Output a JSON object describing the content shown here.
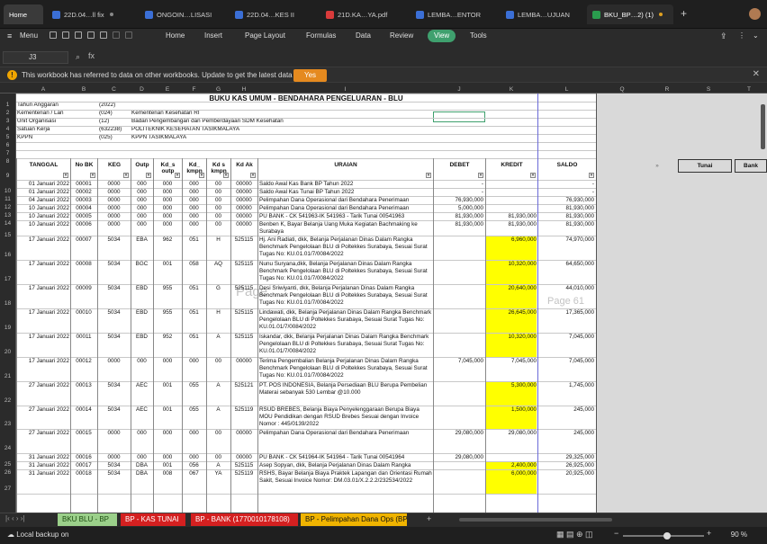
{
  "tabs": [
    {
      "label": "Home"
    },
    {
      "label": "22D.04…ll fix"
    },
    {
      "label": "ONGOIN…LISASI"
    },
    {
      "label": "22D.04…KES II"
    },
    {
      "label": "21D.KA…YA.pdf"
    },
    {
      "label": "LEMBA…ENTOR"
    },
    {
      "label": "LEMBA…UJUAN"
    },
    {
      "label": "BKU_BP…2) (1)"
    }
  ],
  "menu": {
    "menu_label": "Menu",
    "items": [
      "Home",
      "Insert",
      "Page Layout",
      "Formulas",
      "Data",
      "Review",
      "View",
      "Tools"
    ],
    "active": "View"
  },
  "banner": {
    "message": "This workbook has referred to data on other workbooks. Update to get the latest data ?",
    "yes": "Yes"
  },
  "formula": {
    "cell": "J3",
    "fx": "fx"
  },
  "columns": [
    "A",
    "B",
    "C",
    "D",
    "E",
    "F",
    "G",
    "H",
    "I",
    "J",
    "K",
    "L",
    "Q",
    "R",
    "S",
    "T"
  ],
  "title": "BUKU KAS UMUM - BENDAHARA PENGELUARAN - BLU",
  "info": [
    {
      "label": "Tahun Anggaran",
      "code": "(2022)",
      "value": ""
    },
    {
      "label": "Kementerian / Lan",
      "code": "(024)",
      "value": "Kementerian Kesehatan RI"
    },
    {
      "label": "Unit Organisasi",
      "code": "(12)",
      "value": "Badan Pengembangan dan Pemberdayaan SDM Kesehatan"
    },
    {
      "label": "Satuan Kerja",
      "code": "(632238)",
      "value": "POLITEKNIK KESEHATAN TASIKMALAYA"
    },
    {
      "label": "KPPN",
      "code": "(025)",
      "value": "KPPN TASIKMALAYA"
    }
  ],
  "headers": {
    "tanggal": "TANGGAL",
    "nobk": "No BK",
    "keg": "KEG",
    "outp": "Outp",
    "kdsoutp": "Kd_s outp",
    "kdkmpn": "Kd_ kmpn",
    "kdskmpn": "Kd s kmpn",
    "kdak": "Kd Ak",
    "uraian": "URAIAN",
    "debet": "DEBET",
    "kredit": "KREDIT",
    "saldo": "SALDO",
    "tunai": "Tunai",
    "bank": "Bank",
    "arrow": "»"
  },
  "rows": [
    {
      "n": "10",
      "tgl": "01 Januari 2022",
      "bk": "00001",
      "keg": "0000",
      "outp": "000",
      "ks": "000",
      "kk": "000",
      "kks": "00",
      "ak": "00000",
      "ur": "Saldo Awal Kas Bank BP Tahun 2022",
      "d": "-",
      "k": "",
      "s": "-",
      "y": false
    },
    {
      "n": "11",
      "tgl": "01 Januari 2022",
      "bk": "00002",
      "keg": "0000",
      "outp": "000",
      "ks": "000",
      "kk": "000",
      "kks": "00",
      "ak": "00000",
      "ur": "Saldo Awal Kas Tunai BP Tahun 2022",
      "d": "-",
      "k": "",
      "s": "-",
      "y": false
    },
    {
      "n": "12",
      "tgl": "04 Januari 2022",
      "bk": "00003",
      "keg": "0000",
      "outp": "000",
      "ks": "000",
      "kk": "000",
      "kks": "00",
      "ak": "00000",
      "ur": "Pelimpahan Dana Operasional dari Bendahara Penerimaan",
      "d": "76,930,000",
      "k": "",
      "s": "76,930,000",
      "y": false
    },
    {
      "n": "13",
      "tgl": "10 Januari 2022",
      "bk": "00004",
      "keg": "0000",
      "outp": "000",
      "ks": "000",
      "kk": "000",
      "kks": "00",
      "ak": "00000",
      "ur": "Pelimpahan Dana Operasional dari Bendahara Penerimaan",
      "d": "5,000,000",
      "k": "",
      "s": "81,930,000",
      "y": false
    },
    {
      "n": "14",
      "tgl": "10 Januari 2022",
      "bk": "00005",
      "keg": "0000",
      "outp": "000",
      "ks": "000",
      "kk": "000",
      "kks": "00",
      "ak": "00000",
      "ur": "PU BANK - CK 541963-IK 541963 - Tarik Tunai 00541963",
      "d": "81,930,000",
      "k": "81,930,000",
      "s": "81,930,000",
      "y": false
    },
    {
      "n": "15",
      "tgl": "10 Januari 2022",
      "bk": "00006",
      "keg": "0000",
      "outp": "000",
      "ks": "000",
      "kk": "000",
      "kks": "00",
      "ak": "00000",
      "ur": "Benben K, Bayar Belanja Uang Muka Kegiatan Bachmaking ke Surabaya",
      "d": "81,930,000",
      "k": "81,930,000",
      "s": "81,930,000",
      "y": false
    },
    {
      "n": "16",
      "tgl": "17 Januari 2022",
      "bk": "00007",
      "keg": "5034",
      "outp": "EBA",
      "ks": "962",
      "kk": "051",
      "kks": "H",
      "ak": "525115",
      "ur": "Hj. Ani Radiati, dkk, Belanja Perjalanan Dinas Dalam Rangka Benchmark Pengelolaan BLU di Poltekkes Surabaya, Sesuai Surat Tugas No: KU.01.01/7/0084/2022",
      "d": "",
      "k": "6,960,000",
      "s": "74,970,000",
      "y": true
    },
    {
      "n": "17",
      "tgl": "17 Januari 2022",
      "bk": "00008",
      "keg": "5034",
      "outp": "BGC",
      "ks": "001",
      "kk": "058",
      "kks": "AQ",
      "ak": "525115",
      "ur": "Nunu Suryana,dkk, Belanja Perjalanan Dinas Dalam Rangka Benchmark Pengelolaan BLU di Poltekkes Surabaya, Sesuai Surat Tugas No: KU.01.01/7/0084/2022",
      "d": "",
      "k": "10,320,000",
      "s": "64,650,000",
      "y": true
    },
    {
      "n": "18",
      "tgl": "17 Januari 2022",
      "bk": "00009",
      "keg": "5034",
      "outp": "EBD",
      "ks": "955",
      "kk": "051",
      "kks": "G",
      "ak": "525115",
      "ur": "Desi Sriwiyanti, dkk, Belanja Perjalanan Dinas Dalam Rangka Benchmark Pengelolaan BLU di Poltekkes Surabaya, Sesuai Surat Tugas No: KU.01.01/7/0084/2022",
      "d": "",
      "k": "20,640,000",
      "s": "44,010,000",
      "y": true
    },
    {
      "n": "19",
      "tgl": "17 Januari 2022",
      "bk": "00010",
      "keg": "5034",
      "outp": "EBD",
      "ks": "955",
      "kk": "051",
      "kks": "H",
      "ak": "525115",
      "ur": "Lindawati, dkk, Belanja Perjalanan Dinas Dalam Rangka Benchmark Pengelolaan BLU di Poltekkes Surabaya, Sesuai Surat Tugas No: KU.01.01/7/0084/2022",
      "d": "",
      "k": "26,645,000",
      "s": "17,365,000",
      "y": true
    },
    {
      "n": "20",
      "tgl": "17 Januari 2022",
      "bk": "00011",
      "keg": "5034",
      "outp": "EBD",
      "ks": "952",
      "kk": "051",
      "kks": "A",
      "ak": "525115",
      "ur": "Iskandar, dkk, Belanja Perjalanan Dinas Dalam Rangka Benchmark Pengelolaan BLU di Poltekkes Surabaya, Sesuai Surat Tugas No: KU.01.01/7/0084/2022",
      "d": "",
      "k": "10,320,000",
      "s": "7,045,000",
      "y": true
    },
    {
      "n": "21",
      "tgl": "17 Januari 2022",
      "bk": "00012",
      "keg": "0000",
      "outp": "000",
      "ks": "000",
      "kk": "000",
      "kks": "00",
      "ak": "00000",
      "ur": "Terima Pengembalian Belanja Perjalanan Dinas Dalam Rangka Benchmark Pengelolaan BLU di Poltekkes Surabaya, Sesuai Surat Tugas No: KU.01.01/7/0084/2022",
      "d": "7,045,000",
      "k": "7,045,000",
      "s": "7,045,000",
      "y": false
    },
    {
      "n": "22",
      "tgl": "27 Januari 2022",
      "bk": "00013",
      "keg": "5034",
      "outp": "AEC",
      "ks": "001",
      "kk": "055",
      "kks": "A",
      "ak": "525121",
      "ur": "PT. POS INDONESIA, Belanja Persediaan BLU Berupa Pembelian Materai sebanyak 530 Lembar @10.000",
      "d": "",
      "k": "5,300,000",
      "s": "1,745,000",
      "y": true
    },
    {
      "n": "23",
      "tgl": "27 Januari 2022",
      "bk": "00014",
      "keg": "5034",
      "outp": "AEC",
      "ks": "001",
      "kk": "055",
      "kks": "A",
      "ak": "525119",
      "ur": "RSUD BREBES, Belanja Biaya Penyelenggaraan Berupa Biaya MOU Pendidikan dengan RSUD Brebes Sesuai dengan Invoice Nomor : 445/0139/2022",
      "d": "",
      "k": "1,500,000",
      "s": "245,000",
      "y": true
    },
    {
      "n": "24",
      "tgl": "27 Januari 2022",
      "bk": "00015",
      "keg": "0000",
      "outp": "000",
      "ks": "000",
      "kk": "000",
      "kks": "00",
      "ak": "00000",
      "ur": "Pelimpahan Dana Operasional dari Bendahara Penerimaan",
      "d": "29,080,000",
      "k": "29,080,000",
      "s": "245,000",
      "y": false
    },
    {
      "n": "25",
      "tgl": "31 Januari 2022",
      "bk": "00016",
      "keg": "0000",
      "outp": "000",
      "ks": "000",
      "kk": "000",
      "kks": "00",
      "ak": "00000",
      "ur": "PU BANK - CK 541964-IK 541964 - Tarik Tunai 00541964",
      "d": "29,080,000",
      "k": "",
      "s": "29,325,000",
      "y": false
    },
    {
      "n": "26",
      "tgl": "31 Januari 2022",
      "bk": "00017",
      "keg": "5034",
      "outp": "DBA",
      "ks": "001",
      "kk": "056",
      "kks": "A",
      "ak": "525115",
      "ur": "Asep Sopyan, dkk, Belanja Perjalanan Dinas Dalam Rangka Sipenmaru (Promosi) Sesuai Surat Tugas Nomor : PP.01.01.5/0338/2022",
      "d": "",
      "k": "2,400,000",
      "s": "26,925,000",
      "y": true
    },
    {
      "n": "27",
      "tgl": "31 Januari 2022",
      "bk": "00018",
      "keg": "5034",
      "outp": "DBA",
      "ks": "008",
      "kk": "067",
      "kks": "YA",
      "ak": "525119",
      "ur": "RSHS, Bayar Belanja Biaya Praktek Lapangan dan Orientasi Rumah Sakit, Sesuai Invoice Nomor: DM.03.01/X.2.2.2/232534/2022",
      "d": "",
      "k": "6,000,000",
      "s": "20,925,000",
      "y": true
    }
  ],
  "watermark": {
    "page_left": "Page",
    "page_right": "Page 61"
  },
  "sheets": [
    {
      "label": "BKU BLU - BP",
      "color": "#9bd08a",
      "text": "#1e4d12"
    },
    {
      "label": "BP - KAS TUNAI",
      "color": "#d42020",
      "text": "#fff"
    },
    {
      "label": "BP - BANK (1770010178108)",
      "color": "#d42020",
      "text": "#fff"
    },
    {
      "label": "BP - Pelimpahan Dana Ops (BP)",
      "color": "#f0b400",
      "text": "#111"
    }
  ],
  "status": {
    "cloud": "Local backup on",
    "zoom": "90 %"
  }
}
